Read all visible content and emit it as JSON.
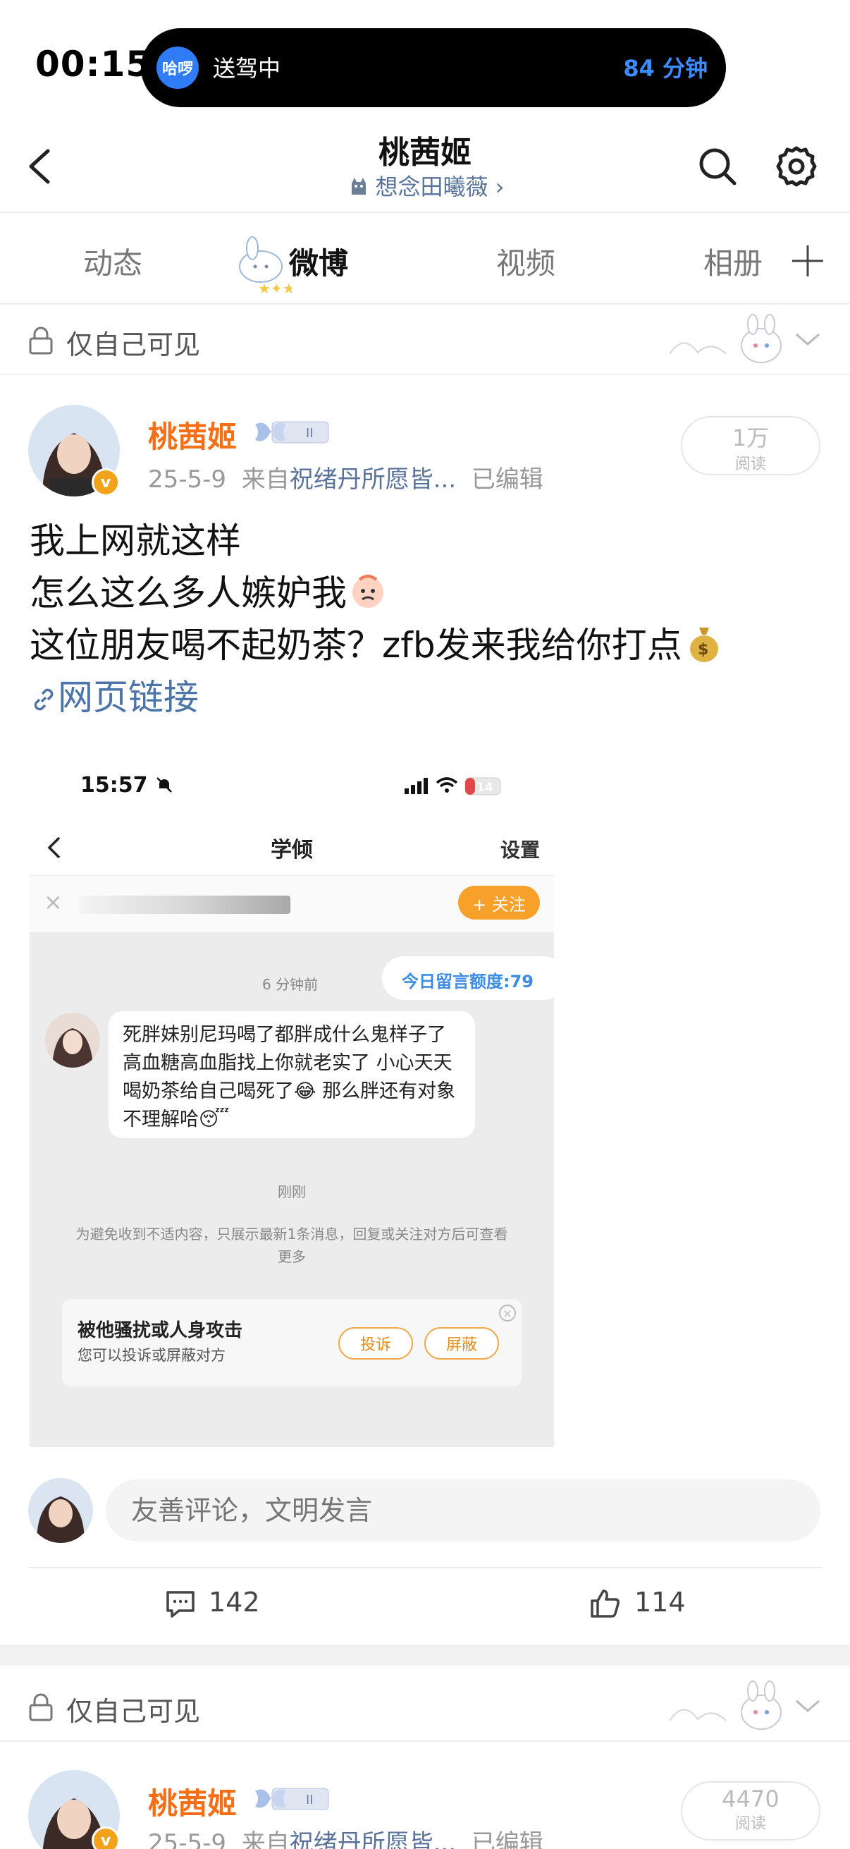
{
  "status_bar": {
    "time": "00:15",
    "island_app": "哈啰",
    "island_title": "送驾中",
    "island_eta": "84 分钟"
  },
  "header": {
    "title": "桃茜姬",
    "subtitle": "想念田曦薇 ›"
  },
  "tabs": [
    {
      "label": "动态",
      "active": false
    },
    {
      "label": "微博",
      "active": true
    },
    {
      "label": "视频",
      "active": false
    },
    {
      "label": "相册",
      "active": false
    }
  ],
  "colors": {
    "accent_orange": "#f56f18",
    "link_blue": "#4d74a8",
    "island_blue": "#3a8cff"
  },
  "posts": [
    {
      "visibility": "仅自己可见",
      "author": "桃茜姬",
      "badge_text": "II",
      "date": "25-5-9",
      "from_prefix": "来自",
      "source": "祝绪丹所愿皆...",
      "edited": "已编辑",
      "reads_value": "1万",
      "reads_label": "阅读",
      "lines": [
        "我上网就这样",
        "怎么这么多人嫉妒我",
        "这位朋友喝不起奶茶？zfb发来我给你打点"
      ],
      "link_text": "网页链接",
      "screenshot": {
        "time": "15:57",
        "battery": "14",
        "nav_title": "学倾",
        "nav_action": "设置",
        "follow_label": "+ 关注",
        "time_ago": "6 分钟前",
        "quota": "今日留言额度:79",
        "message": "死胖妹别尼玛喝了都胖成什么鬼样子了高血糖高血脂找上你就老实了 小心天天喝奶茶给自己喝死了😂 那么胖还有对象 不理解哈😴",
        "just_now": "刚刚",
        "notice": "为避免收到不适内容，只展示最新1条消息，回复或关注对方后可查看更多",
        "card_title": "被他骚扰或人身攻击",
        "card_sub": "您可以投诉或屏蔽对方",
        "btn_report": "投诉",
        "btn_block": "屏蔽"
      },
      "comment_placeholder": "友善评论，文明发言",
      "comments": "142",
      "likes": "114"
    },
    {
      "visibility": "仅自己可见",
      "author": "桃茜姬",
      "badge_text": "II",
      "date": "25-5-9",
      "from_prefix": "来自",
      "source": "祝绪丹所愿皆...",
      "edited": "已编辑",
      "reads_value": "4470",
      "reads_label": "阅读"
    }
  ]
}
